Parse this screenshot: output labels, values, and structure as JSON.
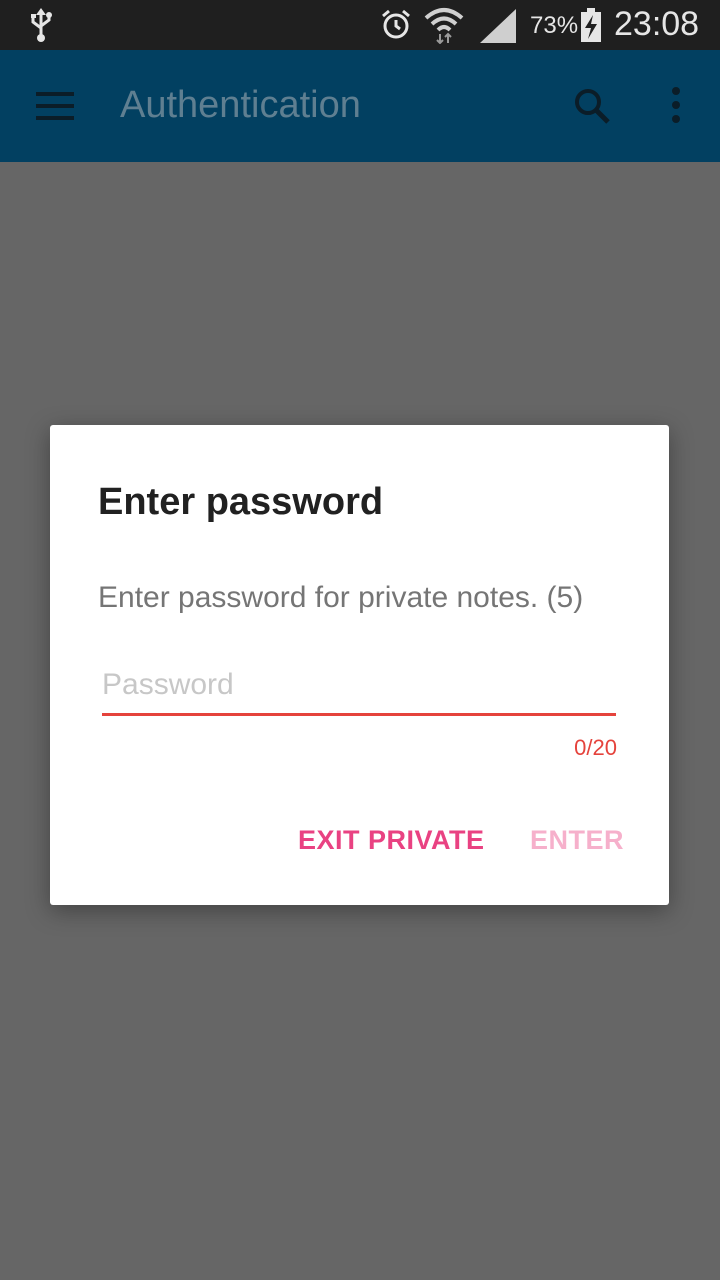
{
  "status_bar": {
    "battery_percent": "73%",
    "time": "23:08",
    "icons": [
      "usb-icon",
      "alarm-icon",
      "wifi-icon",
      "signal-icon",
      "battery-charging-icon"
    ]
  },
  "app_bar": {
    "title": "Authentication",
    "icons": [
      "menu-icon",
      "search-icon",
      "more-vert-icon"
    ],
    "color": "#024061"
  },
  "dialog": {
    "title": "Enter password",
    "message": "Enter password for private notes. (5)",
    "password": {
      "value": "",
      "placeholder": "Password",
      "counter": "0/20"
    },
    "buttons": {
      "exit_label": "EXIT PRIVATE",
      "enter_label": "ENTER"
    },
    "accent_color": "#e94282",
    "error_color": "#e5433c"
  }
}
